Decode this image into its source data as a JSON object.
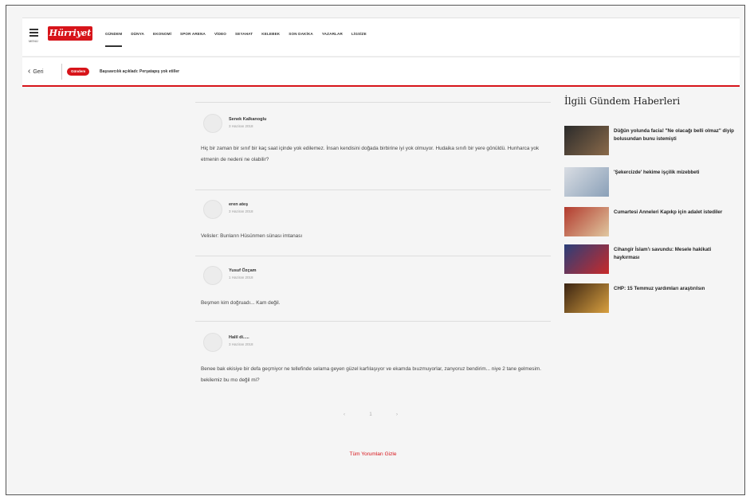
{
  "header": {
    "menu_label": "MENÜ",
    "logo_text": "Hürriyet",
    "nav": [
      "GÜNDEM",
      "DÜNYA",
      "EKONOMİ",
      "SPOR ARENA",
      "VİDEO",
      "SEYAHAT",
      "KELEBEK",
      "SON DAKİKA",
      "YAZARLAR",
      "LİGSİZE"
    ],
    "active_nav_index": 0
  },
  "subbar": {
    "back_label": "Geri",
    "badge_label": "Gündem",
    "title": "Başsavcılık açıkladı: Perşatapış yok etiller"
  },
  "comments": [
    {
      "author": "Senek Kalkanoglu",
      "date": "3 Haziran 2018",
      "text": "Hiç bir zaman bir sınıf bir kaç saat içinde yok edilemez. İnsan kendisini doğada birbirine iyi yok olmuyor. Hudaika sınıfı bir yere gönüldü. Hunharca yok etmenin de nedeni ne olabilir?"
    },
    {
      "author": "eren ateş",
      "date": "3 Haziran 2018",
      "text": "Velisler: Bunların Hüsünmen sünası imtanası"
    },
    {
      "author": "Yusuf Özçam",
      "date": "1 Haziran 2018",
      "text": "Beşmen kim doğruadı... Kam değil."
    },
    {
      "author": "Halil di.....",
      "date": "3 Haziran 2018",
      "text": "Benee bak ekisiye bir defa geçmiyor ne tellefinde selama geyen güzel karfılaşıyor ve ekamda bıuzmuyorlar, zanyoruz bendirim... niye 2 tane gelmesim. bekilemiz bu mo değil mi?"
    }
  ],
  "pager": {
    "prev": "‹",
    "page": "1",
    "next": "›"
  },
  "all_comments_label": "Tüm Yorumları Gizle",
  "related": {
    "title": "İlgili Gündem Haberleri",
    "items": [
      {
        "text": "Düğün yolunda facia! \"Ne olacağı belli olmaz\" diyip bolusundan bunu istemişti",
        "color_a": "#2b2b2b",
        "color_b": "#8a6a4a"
      },
      {
        "text": "'Şekercizde' hekime işçilik mizebbeti",
        "color_a": "#d9dde3",
        "color_b": "#8aa0b8"
      },
      {
        "text": "Cumartesi Anneleri Kapıkp için adalet istediler",
        "color_a": "#b23a2e",
        "color_b": "#e0c8a0"
      },
      {
        "text": "Cihangir İslam'ı savundu: Mesele hakikati haykırması",
        "color_a": "#2a3f7a",
        "color_b": "#c82a2a"
      },
      {
        "text": "CHP: 15 Temmuz yardımları araştırılsın",
        "color_a": "#3a2412",
        "color_b": "#d9a040"
      }
    ]
  }
}
